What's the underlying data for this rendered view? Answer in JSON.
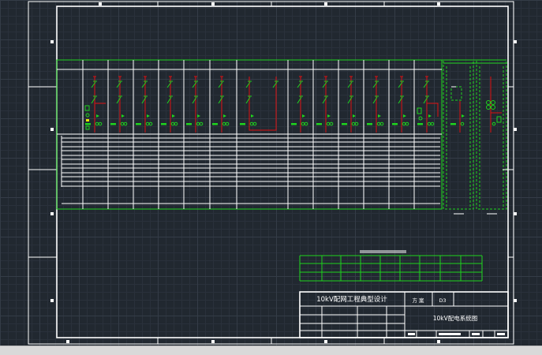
{
  "title_block": {
    "project_title": "10kV配网工程典型设计",
    "scheme_label": "方 案",
    "scheme_value": "D3",
    "drawing_name": "10kV配电系统图"
  },
  "colors": {
    "background": "#212830",
    "grid_minor": "#2a313b",
    "grid_major": "#343c47",
    "frame": "#ffffff",
    "schematic_green": "#1ed41e",
    "feeder_red": "#e01010",
    "marker_yellow": "#e8e800",
    "scrollbar": "#d9d9d9"
  }
}
